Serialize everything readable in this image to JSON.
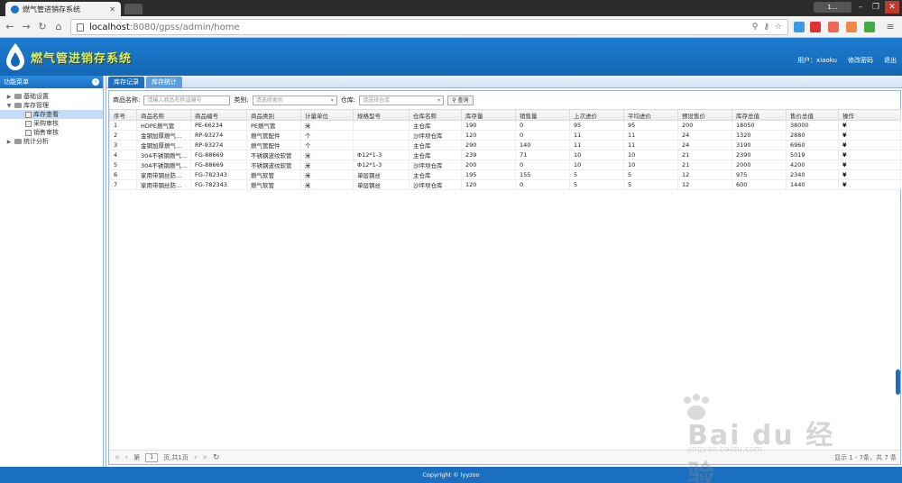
{
  "browser": {
    "tab_title": "燃气管进销存系统",
    "url_host": "localhost",
    "url_path": ":8080/gpss/admin/home",
    "user_badge": "1..."
  },
  "app": {
    "title": "燃气管进销存系统",
    "user_label": "用户：xiaoku",
    "change_password": "修改密码",
    "logout": "退出"
  },
  "sidebar": {
    "title": "功能菜单",
    "items": [
      {
        "label": "基础设置",
        "level": 0,
        "expanded": false
      },
      {
        "label": "库存管理",
        "level": 0,
        "expanded": true
      },
      {
        "label": "库存查看",
        "level": 1,
        "selected": true
      },
      {
        "label": "采购审核",
        "level": 1
      },
      {
        "label": "销售审核",
        "level": 1
      },
      {
        "label": "统计分析",
        "level": 0,
        "expanded": false
      }
    ]
  },
  "tabs": [
    {
      "label": "库存记录",
      "active": true
    },
    {
      "label": "库存统计",
      "active": false
    }
  ],
  "search": {
    "name_label": "商品名称:",
    "name_placeholder": "请输入商品名称或编号",
    "category_label": "类别:",
    "category_placeholder": "请选择类别",
    "warehouse_label": "仓库:",
    "warehouse_placeholder": "请选择仓库",
    "search_button": "查询"
  },
  "table": {
    "columns": [
      "序号",
      "商品名称",
      "商品编号",
      "商品类别",
      "计量单位",
      "规格型号",
      "仓库名称",
      "库存量",
      "销售量",
      "上次进价",
      "平均进价",
      "预设售价",
      "库存总值",
      "售价总值",
      "操作"
    ],
    "rows": [
      [
        "1",
        "HDPE燃气管",
        "PE-66234",
        "PE燃气管",
        "米",
        "",
        "主仓库",
        "190",
        "0",
        "95",
        "95",
        "200",
        "18050",
        "38000",
        "¥"
      ],
      [
        "2",
        "金钢加厚燃气...",
        "RP-93274",
        "燃气管配件",
        "个",
        "",
        "沙坪坝仓库",
        "120",
        "0",
        "11",
        "11",
        "24",
        "1320",
        "2880",
        "¥"
      ],
      [
        "3",
        "金钢加厚燃气...",
        "RP-93274",
        "燃气管配件",
        "个",
        "",
        "主仓库",
        "290",
        "140",
        "11",
        "11",
        "24",
        "3190",
        "6960",
        "¥"
      ],
      [
        "4",
        "304不锈钢燃气...",
        "FG-88669",
        "不锈钢波纹软管",
        "米",
        "Φ12*1-3",
        "主仓库",
        "239",
        "71",
        "10",
        "10",
        "21",
        "2390",
        "5019",
        "¥"
      ],
      [
        "5",
        "304不锈钢燃气...",
        "FG-88669",
        "不锈钢波纹软管",
        "米",
        "Φ12*1-3",
        "沙坪坝仓库",
        "200",
        "0",
        "10",
        "10",
        "21",
        "2000",
        "4200",
        "¥"
      ],
      [
        "6",
        "家用带钢丝防...",
        "FG-782343",
        "燃气软管",
        "米",
        "单层钢丝",
        "主仓库",
        "195",
        "155",
        "5",
        "5",
        "12",
        "975",
        "2340",
        "¥"
      ],
      [
        "7",
        "家用带钢丝防...",
        "FG-782343",
        "燃气软管",
        "米",
        "单层钢丝",
        "沙坪坝仓库",
        "120",
        "0",
        "5",
        "5",
        "12",
        "600",
        "1440",
        "¥"
      ]
    ]
  },
  "pager": {
    "page_prefix": "第",
    "page_value": "1",
    "page_suffix": "页,共1页",
    "info": "显示 1 - 7条，共 7 条"
  },
  "footer": {
    "copyright": "Copyright © lyyzoo"
  },
  "watermark": {
    "text": "Bai du 经验",
    "url": "jingyan.baidu.com"
  },
  "colors": {
    "header_blue": "#1a6fc0",
    "title_yellow": "#d8f25a"
  }
}
